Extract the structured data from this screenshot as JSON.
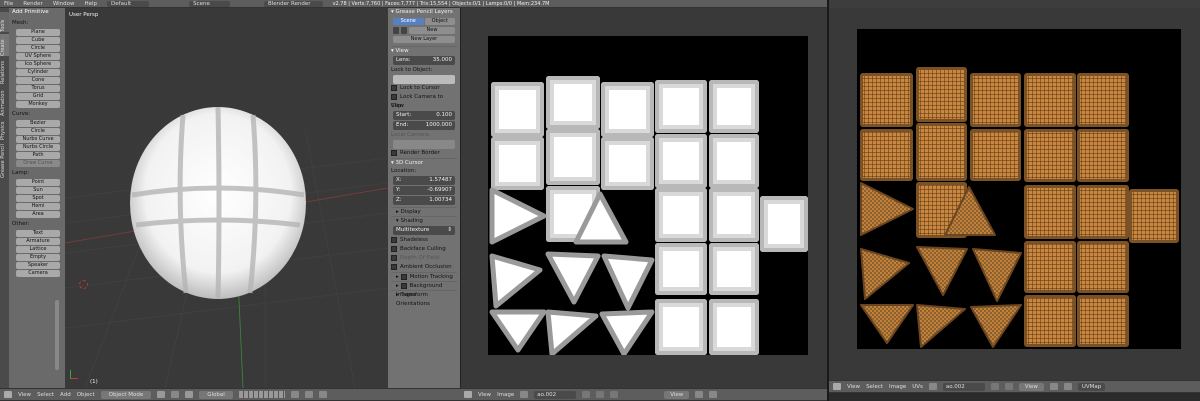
{
  "menubar": {
    "items": [
      "File",
      "Render",
      "Window",
      "Help"
    ],
    "layout": "Default",
    "scene": "Scene",
    "engine": "Blender Render",
    "stats": "v2.78 | Verts:7,760 | Faces:7,777 | Tris:15,554 | Objects:0/1 | Lamps:0/0 | Mem:234.7M"
  },
  "toolshelf": {
    "title": "Add Primitive",
    "sections": [
      {
        "label": "Mesh:",
        "items": [
          "Plane",
          "Cube",
          "Circle",
          "UV Sphere",
          "Ico Sphere",
          "Cylinder",
          "Cone",
          "Torus",
          "Grid",
          "Monkey"
        ]
      },
      {
        "label": "Curve:",
        "items": [
          "Bezier",
          "Circle",
          "Nurbs Curve",
          "Nurbs Circle",
          "Path",
          "Draw Curve"
        ]
      },
      {
        "label": "Lamp:",
        "items": [
          "Point",
          "Sun",
          "Spot",
          "Hemi",
          "Area"
        ]
      },
      {
        "label": "Other:",
        "items": [
          "Text",
          "Armature",
          "Lattice",
          "Empty",
          "Speaker",
          "Camera"
        ]
      }
    ],
    "tabs": [
      "Tools",
      "Create",
      "Relations",
      "Animation",
      "Physics",
      "Grease Pencil"
    ]
  },
  "viewport": {
    "label": "User Persp",
    "object_index": "(1)",
    "header": {
      "items": [
        "View",
        "Select",
        "Add",
        "Object"
      ],
      "mode": "Object Mode",
      "orientation": "Global"
    }
  },
  "properties": {
    "grease_pencil_title": "Grease Pencil Layers",
    "scene_tab": "Scene",
    "object_tab": "Object",
    "new_btn": "New",
    "new_layer_btn": "New Layer",
    "view_title": "View",
    "lens_label": "Lens:",
    "lens_value": "35.000",
    "lock_to_object": "Lock to Object:",
    "lock_to_cursor": "Lock to Cursor",
    "lock_camera": "Lock Camera to View",
    "clip_label": "Clip:",
    "clip_start_label": "Start:",
    "clip_start": "0.100",
    "clip_end_label": "End:",
    "clip_end": "1000.000",
    "local_camera": "Local Camera:",
    "render_border": "Render Border",
    "cursor_title": "3D Cursor",
    "location_label": "Location:",
    "x_label": "X:",
    "x_value": "1.57487",
    "y_label": "Y:",
    "y_value": "-0.69907",
    "z_label": "Z:",
    "z_value": "1.00734",
    "display_title": "Display",
    "shading_title": "Shading",
    "shading_mode": "Multitexture",
    "shading_opts": [
      "Shadeless",
      "Backface Culling",
      "Depth Of Field",
      "Ambient Occlusion"
    ],
    "motion_tracking": "Motion Tracking",
    "background_images": "Background Images",
    "transform_orientations": "Transform Orientations"
  },
  "uv_editor_1": {
    "items": [
      "View",
      "Image"
    ],
    "image": "ao.002",
    "view_btn": "View"
  },
  "uv_editor_2": {
    "items": [
      "View",
      "Select",
      "Image",
      "UVs"
    ],
    "image": "ao.002",
    "view_btn": "View",
    "uvmap": "UVMap"
  },
  "colors": {
    "accent_blue": "#5680c2",
    "viewport_bg": "#393939",
    "black": "#000000",
    "wicker": "#c9873f"
  }
}
